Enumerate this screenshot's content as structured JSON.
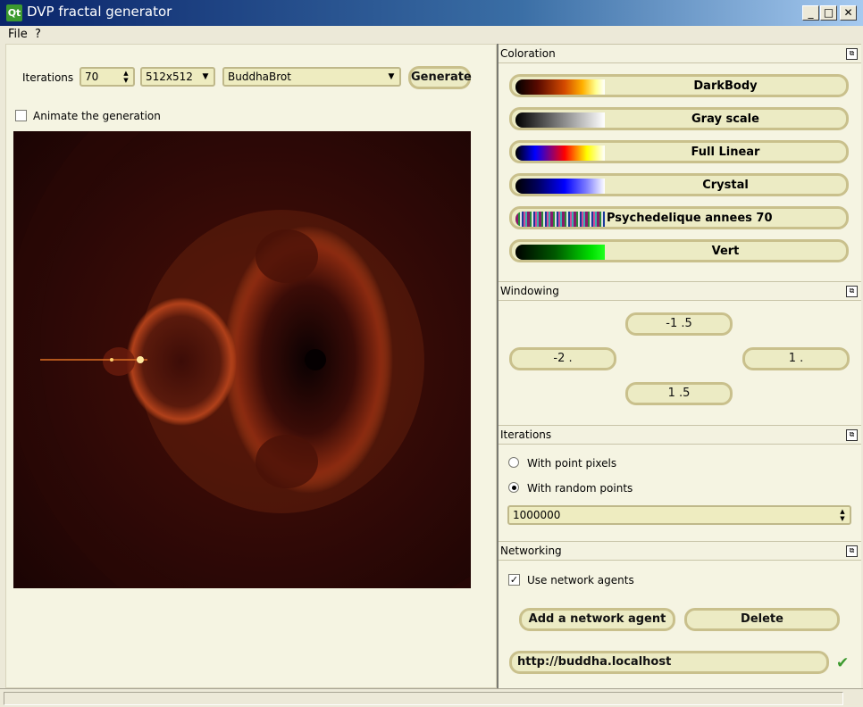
{
  "window": {
    "title": "DVP fractal generator",
    "qt_logo": "Qt",
    "minimize_glyph": "_",
    "maximize_glyph": "□",
    "close_glyph": "✕"
  },
  "menu": {
    "file": "File",
    "help": "?"
  },
  "toolbar": {
    "iterations_label": "Iterations",
    "iterations_value": "70",
    "size_value": "512x512",
    "fractal_value": "BuddhaBrot",
    "generate_label": "Generate"
  },
  "animate": {
    "label": "Animate the generation",
    "checked": false
  },
  "coloration": {
    "title": "Coloration",
    "items": [
      {
        "label": "DarkBody"
      },
      {
        "label": "Gray scale"
      },
      {
        "label": "Full Linear"
      },
      {
        "label": "Crystal"
      },
      {
        "label": "Psychedelique annees 70"
      },
      {
        "label": "Vert"
      }
    ]
  },
  "windowing": {
    "title": "Windowing",
    "top": "-1 .5",
    "left": "-2 .",
    "right": "1 .",
    "bottom": "1 .5"
  },
  "iterations_panel": {
    "title": "Iterations",
    "option_pixels": "With point pixels",
    "option_random": "With random points",
    "selected": "With random points",
    "points_value": "1000000"
  },
  "networking": {
    "title": "Networking",
    "use_agents_label": "Use network agents",
    "use_agents_checked": true,
    "add_label": "Add a network agent",
    "delete_label": "Delete",
    "agent_url": "http://buddha.localhost"
  },
  "colors": {
    "accent_border": "#c9c08c",
    "button_fill": "#ecebc4",
    "ok_check": "#3c9a2f"
  }
}
